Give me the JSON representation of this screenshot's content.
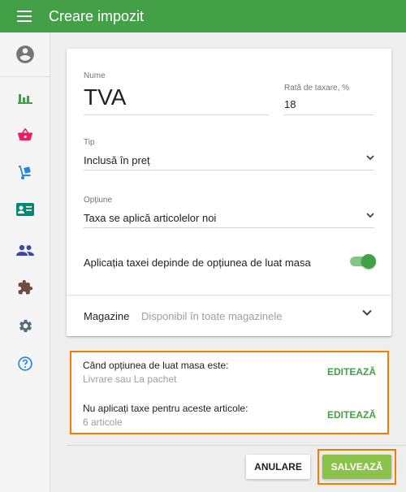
{
  "header": {
    "title": "Creare impozit",
    "menu_icon": "menu-icon"
  },
  "sidebar": {
    "items": [
      {
        "icon": "account-circle-icon",
        "color": "#757575"
      },
      {
        "icon": "bar-chart-icon",
        "color": "#43a047"
      },
      {
        "icon": "shopping-basket-icon",
        "color": "#e91e63"
      },
      {
        "icon": "dolly-icon",
        "color": "#1e88e5"
      },
      {
        "icon": "contact-card-icon",
        "color": "#00897b"
      },
      {
        "icon": "people-icon",
        "color": "#3949ab"
      },
      {
        "icon": "puzzle-icon",
        "color": "#6d4c41"
      },
      {
        "icon": "gear-icon",
        "color": "#546e7a"
      },
      {
        "icon": "help-icon",
        "color": "#1e88e5"
      }
    ]
  },
  "form": {
    "name_label": "Nume",
    "name_value": "TVA",
    "rate_label": "Rată de taxare, %",
    "rate_value": "18",
    "type_label": "Tip",
    "type_value": "Inclusă în preț",
    "option_label": "Opțiune",
    "option_value": "Taxa se aplică articolelor noi",
    "toggle_label": "Aplicația taxei depinde de opțiunea de luat masa",
    "toggle_on": true,
    "stores_label": "Magazine",
    "stores_value": "Disponibil în toate magazinele"
  },
  "options": {
    "dining": {
      "title": "Când opțiunea de luat masa este:",
      "subtitle": "Livrare sau La pachet",
      "edit": "EDITEAZĂ"
    },
    "items": {
      "title": "Nu aplicați taxe pentru aceste articole:",
      "subtitle": "6 articole",
      "edit": "EDITEAZĂ"
    }
  },
  "actions": {
    "cancel": "ANULARE",
    "save": "SALVEAZĂ"
  },
  "colors": {
    "primary": "#43a047",
    "save": "#8bc34a",
    "highlight": "#f57c00"
  }
}
